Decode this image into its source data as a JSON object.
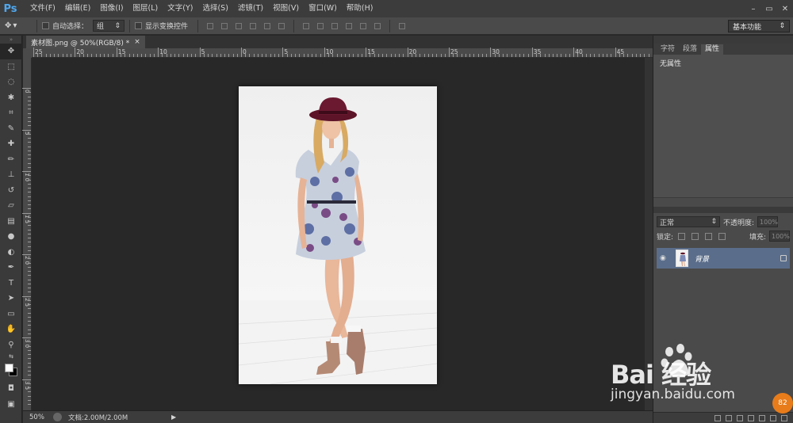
{
  "app": {
    "logo": "Ps"
  },
  "menu": [
    "文件(F)",
    "编辑(E)",
    "图像(I)",
    "图层(L)",
    "文字(Y)",
    "选择(S)",
    "滤镜(T)",
    "视图(V)",
    "窗口(W)",
    "帮助(H)"
  ],
  "window_controls": {
    "minimize": "–",
    "restore": "▭",
    "close": "✕"
  },
  "options": {
    "auto_select_label": "自动选择：",
    "auto_select_value": "组",
    "show_transform_label": "显示变换控件",
    "workspace": "基本功能"
  },
  "document": {
    "tab_title": "素材图.png @ 50%(RGB/8) *",
    "tab_close": "×"
  },
  "rulers": {
    "top_labels": [
      "25",
      "20",
      "15",
      "10",
      "5",
      "0",
      "5",
      "10",
      "15",
      "20",
      "25",
      "30",
      "35",
      "40",
      "45"
    ],
    "left_labels": [
      "0",
      "5",
      "1 0",
      "1 5",
      "2 0",
      "2 5",
      "3 0",
      "3 5"
    ]
  },
  "status": {
    "zoom": "50%",
    "doc_info": "文档:2.00M/2.00M",
    "arrow": "▶"
  },
  "panels": {
    "tabs": [
      "字符",
      "段落",
      "属性"
    ],
    "active_tab": "属性",
    "properties_text": "无属性"
  },
  "layers": {
    "blend_mode": "正常",
    "opacity_label": "不透明度:",
    "opacity_value": "100%",
    "lock_label": "锁定:",
    "fill_label": "填充:",
    "fill_value": "100%",
    "layer_name": "背景"
  },
  "watermark": {
    "brand": "Bai  经验",
    "url": "jingyan.baidu.com",
    "badge": "82"
  },
  "colors": {
    "accent": "#4fa8f0",
    "layer_selected": "#5a6d8a"
  }
}
